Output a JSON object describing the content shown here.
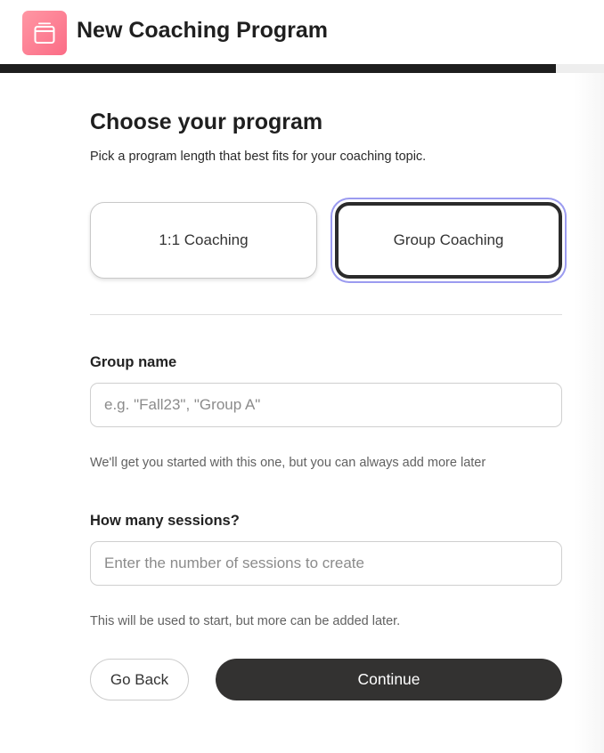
{
  "header": {
    "app_icon": "stack-icon",
    "title": "New Coaching Program",
    "progress_fraction": 0.92,
    "progress_color": "#1e1e1e",
    "icon_gradient": [
      "#ff97a4",
      "#fb6c86"
    ]
  },
  "step": {
    "heading": "Choose your program",
    "subheading": "Pick a program length that best fits for your coaching topic.",
    "options": [
      {
        "label": "1:1 Coaching",
        "selected": false
      },
      {
        "label": "Group Coaching",
        "selected": true
      }
    ]
  },
  "group_name": {
    "label": "Group name",
    "value": "",
    "placeholder": "e.g. \"Fall23\", \"Group A\"",
    "helper": "We'll get you started with this one, but you can always add more later"
  },
  "sessions": {
    "label": "How many sessions?",
    "value": "",
    "placeholder": "Enter the number of sessions to create",
    "helper": "This will be used to start, but more can be added later."
  },
  "footer": {
    "back_label": "Go Back",
    "continue_label": "Continue",
    "continue_color": "#333231"
  }
}
